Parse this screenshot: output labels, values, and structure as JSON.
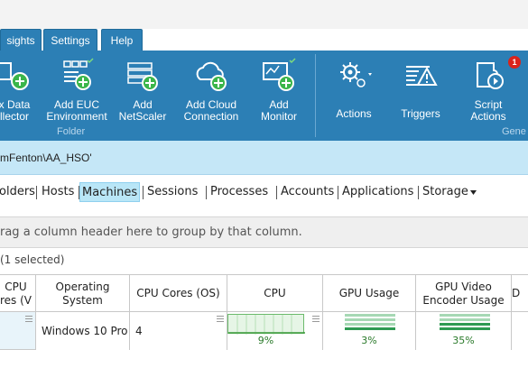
{
  "menu_tabs": [
    "sights",
    "Settings",
    "Help"
  ],
  "ribbon": {
    "buttons": [
      {
        "name": "add-data-collector",
        "label": "x Data\nllector"
      },
      {
        "name": "add-euc-environment",
        "label": "Add EUC\nEnvironment"
      },
      {
        "name": "add-netscaler",
        "label": "Add\nNetScaler"
      },
      {
        "name": "add-cloud-connection",
        "label": "Add Cloud\nConnection"
      },
      {
        "name": "add-monitor",
        "label": "Add\nMonitor"
      },
      {
        "name": "actions",
        "label": "Actions"
      },
      {
        "name": "triggers",
        "label": "Triggers"
      },
      {
        "name": "script-actions",
        "label": "Script\nActions"
      }
    ],
    "folder_group": "Folder",
    "general_group": "Gene",
    "script_badge": "1"
  },
  "scope_path": "mFenton\\AA_HSO'",
  "view_tabs": [
    "olders",
    "Hosts",
    "Machines",
    "Sessions",
    "Processes",
    "Accounts",
    "Applications",
    "Storage"
  ],
  "active_view_tab": "Machines",
  "group_by_hint": "rag a column header here to group by that column.",
  "selection_count": "(1 selected)",
  "grid": {
    "headers": [
      "CPU\nres (V",
      "Operating\nSystem",
      "CPU Cores (OS)",
      "CPU",
      "GPU Usage",
      "GPU Video\nEncoder Usage",
      "D"
    ],
    "row": {
      "os": "Windows 10 Pro",
      "cpu_cores_os": "4",
      "cpu": "9%",
      "gpu_usage": "3%",
      "gpu_video_encoder": "35%"
    }
  },
  "colors": {
    "ribbon": "#2c7fb5",
    "scope_bar": "#c5e7f7",
    "active_tab": "#b9e6f7",
    "badge": "#d9241c"
  }
}
